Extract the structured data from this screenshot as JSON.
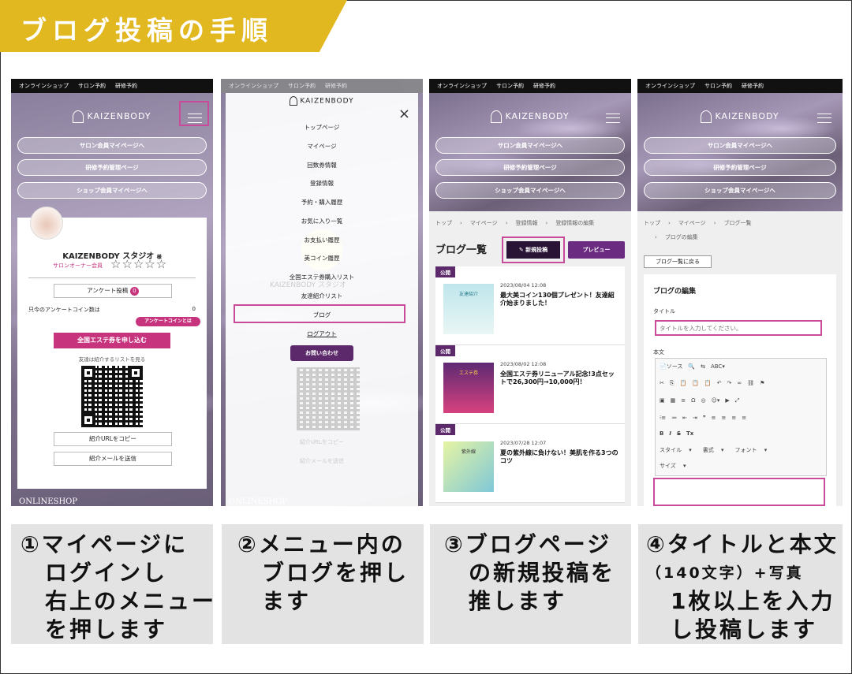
{
  "title": "ブログ投稿の手順",
  "colors": {
    "accent_yellow": "#e2b820",
    "highlight_pink": "#c94a98",
    "brand_magenta": "#c8337e",
    "brand_purple": "#5c2a6a"
  },
  "common": {
    "topnav": [
      "オンラインショップ",
      "サロン予約",
      "研修予約"
    ],
    "logo": "KAIZENBODY",
    "menu_pills": [
      "サロン会員マイページへ",
      "研修予約管理ページ",
      "ショップ会員マイページへ"
    ],
    "footer": "ONLINESHOP"
  },
  "step1": {
    "user_name": "KAIZENBODY スタジオ",
    "user_suffix": "様",
    "role": "サロンオーナー会員",
    "stars": "☆☆☆☆☆",
    "survey_btn": "アンケート投稿",
    "survey_count": "0",
    "coin_label": "只今のアンケートコイン数は",
    "coin_value": "0",
    "coin_about": "アンケートコインとは",
    "apply_btn": "全国エステ券を申し込む",
    "friend_note": "友達は紹介するリストを見る",
    "copy_url": "紹介URLをコピー",
    "send_mail": "紹介メールを送信"
  },
  "step2": {
    "close": "×",
    "items": [
      "トップページ",
      "マイページ",
      "回数券情報",
      "登録情報",
      "予約・購入履歴",
      "お気に入り一覧",
      "お支払い履歴",
      "美コイン履歴",
      "全国エステ券購入リスト",
      "友達紹介リスト",
      "ブログ"
    ],
    "logout": "ログアウト",
    "contact": "お問い合わせ",
    "bg_name": "KAIZENBODY スタジオ",
    "bg_copy": "紹介URLをコピー",
    "bg_mail": "紹介メールを送信"
  },
  "step3": {
    "crumbs": [
      "トップ",
      "›",
      "マイページ",
      "›",
      "登録情報",
      "›",
      "登録情報の編集"
    ],
    "heading": "ブログ一覧",
    "new_post": "新規投稿",
    "preview": "プレビュー",
    "posts": [
      {
        "badge": "公開",
        "date": "2023/08/04 12:08",
        "title": "最大美コイン130個プレゼント！友達紹介始まりました！",
        "thumb": "友達紹介"
      },
      {
        "badge": "公開",
        "date": "2023/08/02 12:08",
        "title": "全国エステ券リニューアル記念!3点セットで26,300円→10,000円！",
        "thumb": "エステ券"
      },
      {
        "badge": "公開",
        "date": "2023/07/28 12:07",
        "title": "夏の紫外線に負けない！美肌を作る3つのコツ",
        "thumb": "紫外線"
      }
    ]
  },
  "step4": {
    "crumbs1": [
      "トップ",
      "›",
      "マイページ",
      "›",
      "ブログ一覧"
    ],
    "crumbs2": [
      "›",
      "ブログの編集"
    ],
    "back": "ブログ一覧に戻る",
    "section": "ブログの編集",
    "title_label": "タイトル",
    "title_placeholder": "タイトルを入力してください。",
    "body_label": "本文",
    "toolbar1": [
      "📄ソース",
      "🔍",
      "⇆",
      "ABC▾"
    ],
    "toolbar2": [
      "✂",
      "⎘",
      "📋",
      "📋",
      "📋",
      "↶",
      "↷",
      "∞",
      "⛓",
      "⚑"
    ],
    "toolbar3": [
      "▣",
      "▦",
      "≡",
      "Ω",
      "◎",
      "☺▾",
      "▶",
      "⤢"
    ],
    "toolbar4": [
      "⁝≡",
      "≔",
      "⇤",
      "⇥",
      "❞",
      "≡",
      "≡",
      "≡",
      "≡"
    ],
    "toolbar5": [
      "B",
      "I",
      "S",
      "Tx"
    ],
    "style_sel": "スタイル",
    "format_sel": "書式",
    "font_sel": "フォント",
    "size_sel": "サイズ"
  },
  "captions": {
    "c1": [
      "①マイページに",
      "　ログインし",
      "　右上のメニュー",
      "　を押します"
    ],
    "c2": [
      "②メニュー内の",
      "　ブログを押し",
      "　ます"
    ],
    "c3": [
      "③ブログページ",
      "　の新規投稿を",
      "　推します"
    ],
    "c4_1": "④タイトルと本文",
    "c4_2": "（140文字）+写真",
    "c4_3": "　1枚以上を入力",
    "c4_4": "　し投稿します"
  }
}
